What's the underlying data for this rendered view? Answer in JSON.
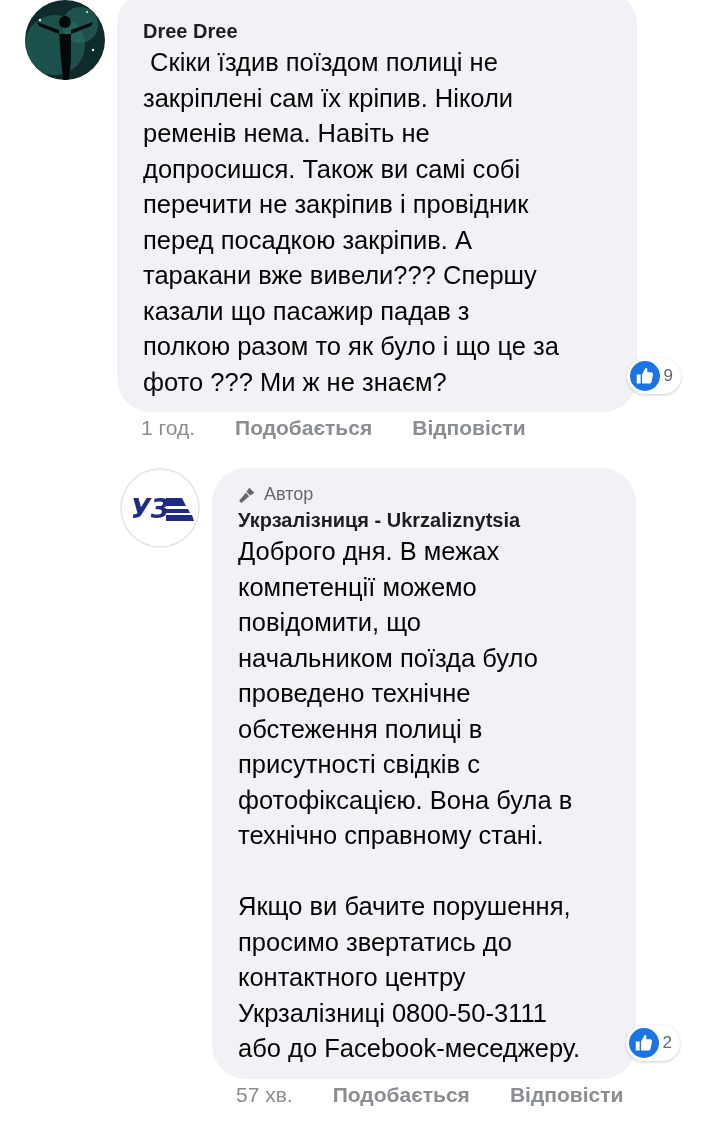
{
  "comments": [
    {
      "kind": "comment",
      "author": "Dree Dree",
      "avatar": {
        "kind": "picture"
      },
      "paragraphs": [
        " Скіки їздив поїздом полиці не\nзакріплені сам їх кріпив. Ніколи\nременів нема. Навіть не\nдопросишся. Також ви самі собі\nперечити не закріпив і провідник\nперед посадкою закріпив. А\nтаракани вже вивели??? Спершу\nказали що пасажир падав з\nполкою разом то як було і що це за\nфото ??? Ми ж не знаєм?"
      ],
      "reactions": "9",
      "time": "1 год.",
      "like": "Подобається",
      "reply": "Відповісти"
    },
    {
      "kind": "reply",
      "author": "Укрзалізниця - Ukrzaliznytsia",
      "badge": "Автор",
      "avatar": {
        "kind": "logo",
        "text": "УЗ"
      },
      "paragraphs": [
        "Доброго дня. В межах\nкомпетенції можемо\nповідомити, що\nначальником поїзда було\nпроведено технічне\nобстеження полиці в\nприсутності свідків с\nфотофіксацією. Вона була в\nтехнічно справному стані.",
        "Якщо ви бачите порушення,\nпросимо звертатись до\nконтактного центру\nУкрзалізниці 0800-50-3111\nабо до Facebook-меседжеру."
      ],
      "reactions": "2",
      "time": "57 хв.",
      "like": "Подобається",
      "reply": "Відповісти"
    }
  ]
}
